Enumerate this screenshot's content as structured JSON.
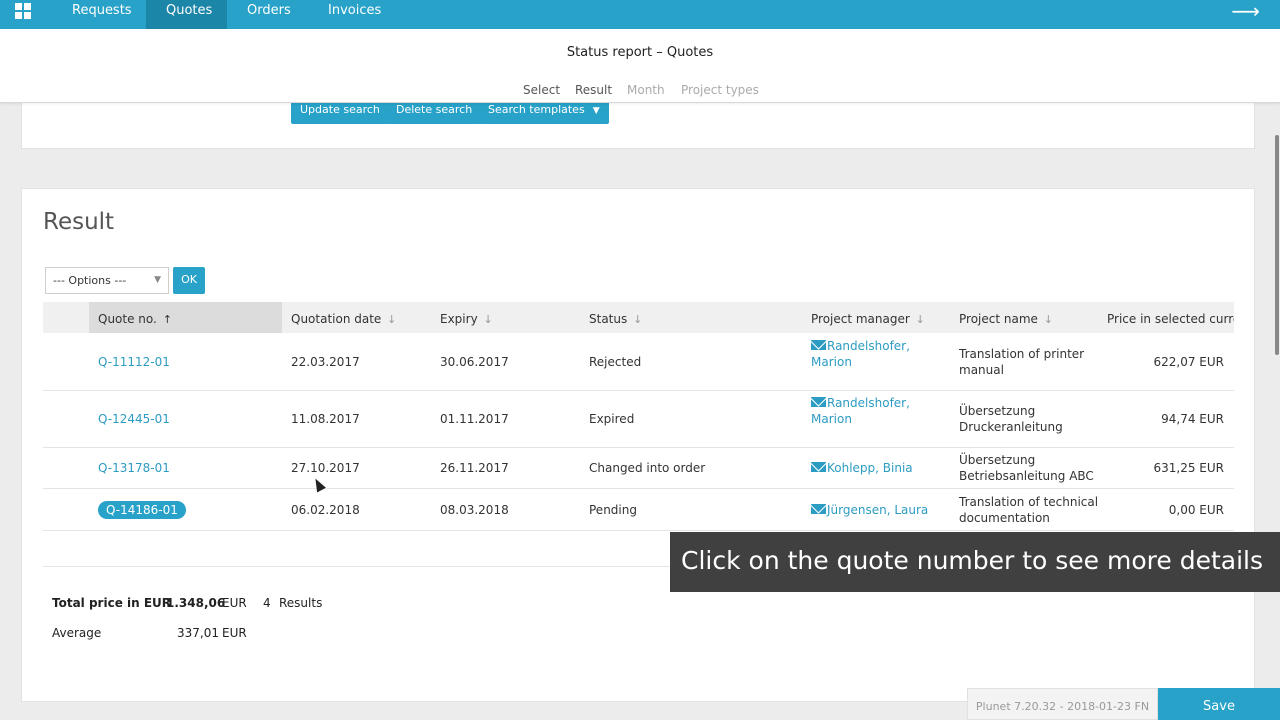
{
  "nav": {
    "tabs": [
      "Requests",
      "Quotes",
      "Orders",
      "Invoices"
    ],
    "active_tab": "Quotes",
    "exit_icon": "arrow-right-icon"
  },
  "header": {
    "title": "Status report – Quotes",
    "steps": [
      "Select",
      "Result",
      "Month",
      "Project types"
    ]
  },
  "search_actions": {
    "update": "Update search",
    "delete": "Delete search",
    "templates": "Search templates"
  },
  "result": {
    "title": "Result",
    "options_placeholder": "--- Options ---",
    "ok": "OK",
    "columns": {
      "quote_no": "Quote no.",
      "quotation_date": "Quotation date",
      "expiry": "Expiry",
      "status": "Status",
      "project_manager": "Project manager",
      "project_name": "Project name",
      "price": "Price in selected curren"
    },
    "rows": [
      {
        "quote_no": "Q-11112-01",
        "date": "22.03.2017",
        "expiry": "30.06.2017",
        "status": "Rejected",
        "pm_line1": "Randelshofer,",
        "pm_line2": "Marion",
        "name_line1": "Translation of printer",
        "name_line2": "manual",
        "price": "622,07 EUR"
      },
      {
        "quote_no": "Q-12445-01",
        "date": "11.08.2017",
        "expiry": "01.11.2017",
        "status": "Expired",
        "pm_line1": "Randelshofer,",
        "pm_line2": "Marion",
        "name_line1": "Übersetzung",
        "name_line2": "Druckeranleitung",
        "price": "94,74 EUR"
      },
      {
        "quote_no": "Q-13178-01",
        "date": "27.10.2017",
        "expiry": "26.11.2017",
        "status": "Changed into order",
        "pm_line1": "Kohlepp, Binia",
        "pm_line2": "",
        "name_line1": "Übersetzung",
        "name_line2": "Betriebsanleitung ABC",
        "price": "631,25 EUR"
      },
      {
        "quote_no": "Q-14186-01",
        "date": "06.02.2018",
        "expiry": "08.03.2018",
        "status": "Pending",
        "pm_line1": "Jürgensen, Laura",
        "pm_line2": "",
        "name_line1": "Translation of technical",
        "name_line2": "documentation",
        "price": "0,00 EUR"
      }
    ],
    "totals": {
      "total_label": "Total price in EUR",
      "total_value": "1.348,06",
      "total_currency": "EUR",
      "count": "4",
      "count_label": "Results",
      "average_label": "Average",
      "average_value": "337,01",
      "average_currency": "EUR"
    }
  },
  "tooltip": "Click on the quote number to see more details",
  "footer": {
    "version": "Plunet 7.20.32 - 2018-01-23 FN",
    "save": "Save"
  },
  "colors": {
    "accent": "#28a2c8",
    "link": "#2d9cc2"
  }
}
